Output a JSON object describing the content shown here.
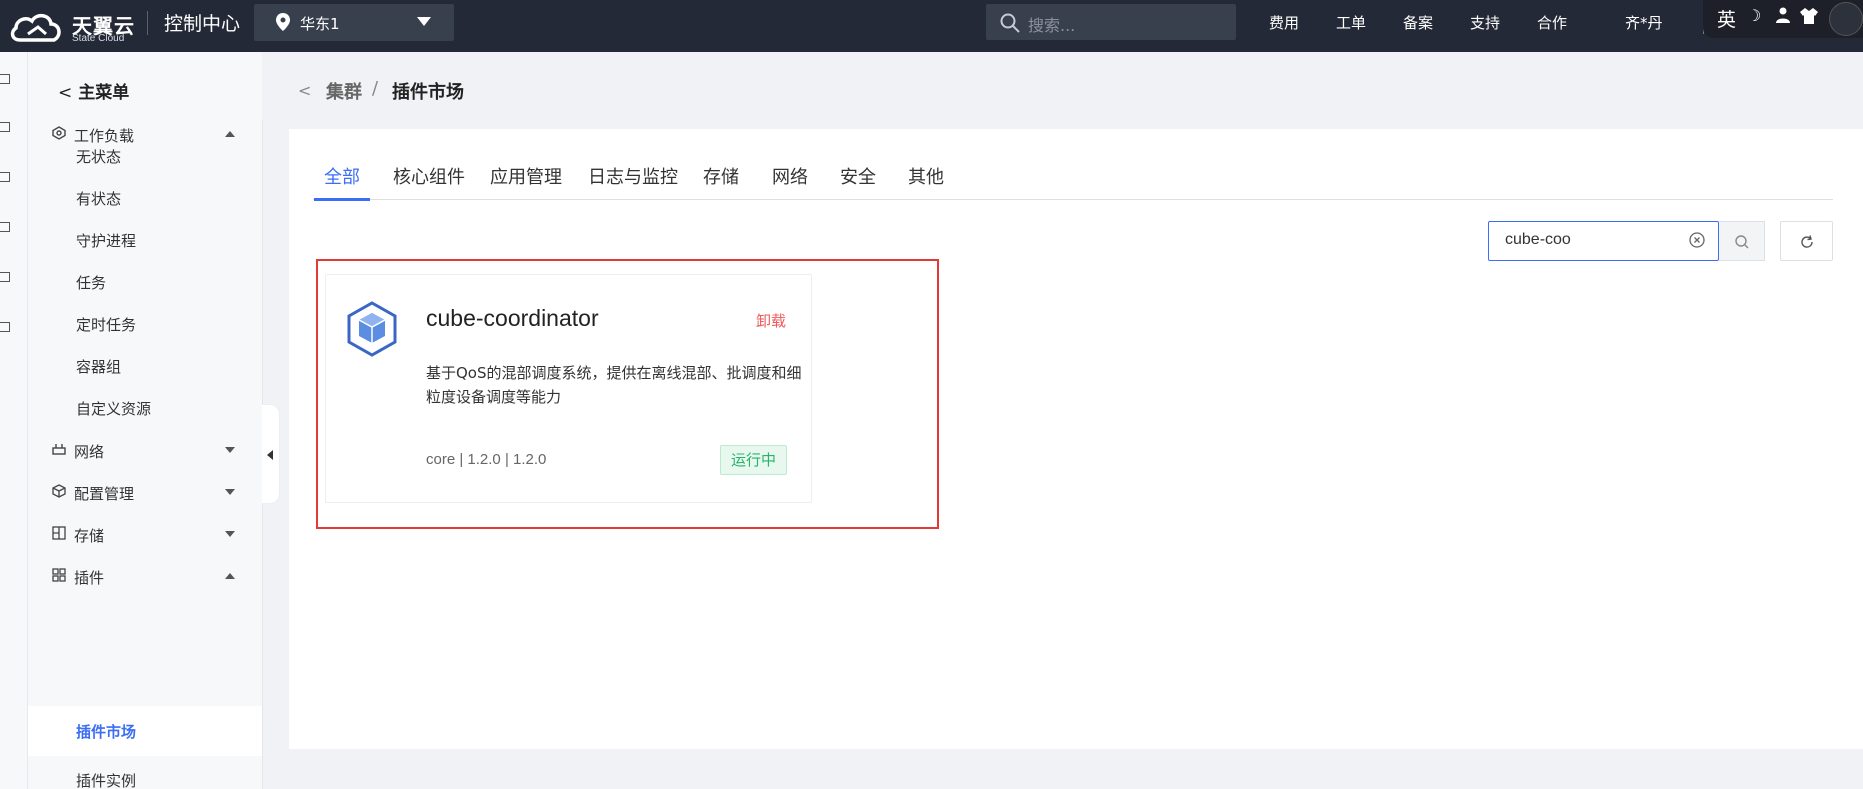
{
  "topbar": {
    "logo_cn": "天翼云",
    "logo_en": "State Cloud",
    "console_title": "控制中心",
    "region": "华东1",
    "search_placeholder": "搜索...",
    "links": [
      "费用",
      "工单",
      "备案",
      "支持",
      "合作"
    ],
    "user": "齐*丹",
    "ime_lang": "英"
  },
  "sidebar": {
    "back_label": "主菜单",
    "groups": [
      {
        "label": "工作负载",
        "icon": "workload-icon",
        "expanded": true
      },
      {
        "label": "网络",
        "icon": "network-icon",
        "expanded": false
      },
      {
        "label": "配置管理",
        "icon": "config-icon",
        "expanded": false
      },
      {
        "label": "存储",
        "icon": "storage-icon",
        "expanded": false
      },
      {
        "label": "插件",
        "icon": "plugin-icon",
        "expanded": true
      }
    ],
    "workload_items": [
      "无状态",
      "有状态",
      "守护进程",
      "任务",
      "定时任务",
      "容器组",
      "自定义资源"
    ],
    "plugin_items": [
      "插件市场",
      "插件实例"
    ],
    "active_item": "插件市场"
  },
  "breadcrumb": {
    "parent": "集群",
    "separator": "/",
    "current": "插件市场"
  },
  "tabs": [
    {
      "label": "全部",
      "active": true
    },
    {
      "label": "核心组件",
      "active": false
    },
    {
      "label": "应用管理",
      "active": false
    },
    {
      "label": "日志与监控",
      "active": false
    },
    {
      "label": "存储",
      "active": false
    },
    {
      "label": "网络",
      "active": false
    },
    {
      "label": "安全",
      "active": false
    },
    {
      "label": "其他",
      "active": false
    }
  ],
  "filter": {
    "value": "cube-coo"
  },
  "plugins": [
    {
      "name": "cube-coordinator",
      "action": "卸载",
      "description": "基于QoS的混部调度系统，提供在离线混部、批调度和细粒度设备调度等能力",
      "meta": "core | 1.2.0 | 1.2.0",
      "status": "运行中"
    }
  ],
  "colors": {
    "accent": "#3b6ef5",
    "topbar": "#232936",
    "danger": "#f05a5a",
    "success": "#28b36b",
    "highlight_border": "#e53935"
  }
}
